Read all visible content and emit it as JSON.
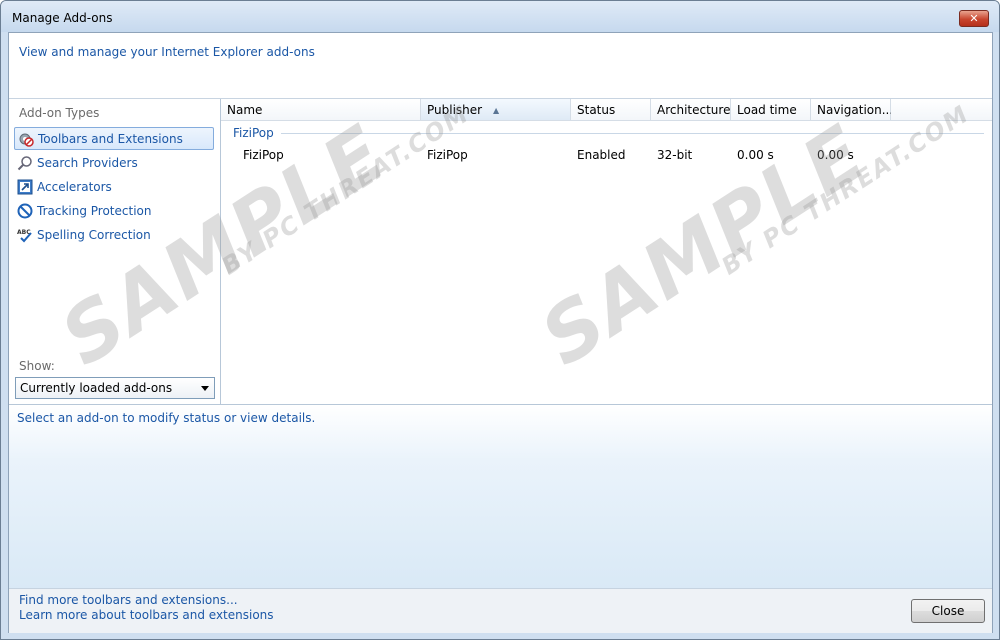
{
  "window": {
    "title": "Manage Add-ons",
    "close_glyph": "✕"
  },
  "header": {
    "text": "View and manage your Internet Explorer add-ons"
  },
  "sidebar": {
    "title": "Add-on Types",
    "items": [
      {
        "label": "Toolbars and Extensions",
        "icon": "gear-block-icon"
      },
      {
        "label": "Search Providers",
        "icon": "magnifier-icon"
      },
      {
        "label": "Accelerators",
        "icon": "accelerator-icon"
      },
      {
        "label": "Tracking Protection",
        "icon": "no-entry-icon"
      },
      {
        "label": "Spelling Correction",
        "icon": "abc-check-icon"
      }
    ],
    "show_label": "Show:",
    "show_value": "Currently loaded add-ons"
  },
  "list": {
    "columns": [
      "Name",
      "Publisher",
      "Status",
      "Architecture",
      "Load time",
      "Navigation..."
    ],
    "group": "FiziPop",
    "rows": [
      {
        "name": "FiziPop",
        "publisher": "FiziPop",
        "status": "Enabled",
        "architecture": "32-bit",
        "load_time": "0.00 s",
        "navigation": "0.00 s"
      }
    ]
  },
  "details": {
    "text": "Select an add-on to modify status or view details."
  },
  "footer": {
    "link1": "Find more toolbars and extensions...",
    "link2": "Learn more about toolbars and extensions",
    "close_label": "Close"
  },
  "watermark": {
    "big": "SAMPLE",
    "small": "BY PC THREAT.COM"
  },
  "colors": {
    "accent_link": "#1b57a6",
    "title_close": "#c8452e"
  }
}
